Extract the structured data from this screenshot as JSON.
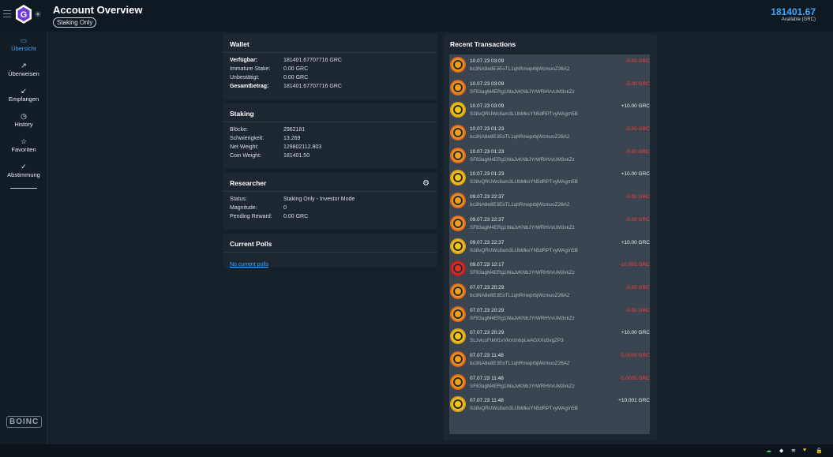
{
  "header": {
    "title": "Account Overview",
    "mode_badge": "Staking Only",
    "balance": "181401.67",
    "balance_label": "Available (GRC)"
  },
  "sidebar": {
    "items": [
      {
        "label": "Übersicht",
        "icon": "overview-icon",
        "glyph": "▭",
        "active": true
      },
      {
        "label": "Überweisen",
        "icon": "send-arrow-icon",
        "glyph": "↗",
        "active": false
      },
      {
        "label": "Empfangen",
        "icon": "receive-arrow-icon",
        "glyph": "↙",
        "active": false
      },
      {
        "label": "History",
        "icon": "clock-icon",
        "glyph": "◷",
        "active": false
      },
      {
        "label": "Favoriten",
        "icon": "star-icon",
        "glyph": "☆",
        "active": false
      },
      {
        "label": "Abstimmung",
        "icon": "check-icon",
        "glyph": "✓",
        "active": false
      }
    ],
    "footer_logo": "BOINC"
  },
  "wallet": {
    "title": "Wallet",
    "rows": [
      {
        "label": "Verfügbar:",
        "value": "181401.67707716 GRC",
        "bold": true
      },
      {
        "label": "Immature Stake:",
        "value": "0.00 GRC",
        "bold": false
      },
      {
        "label": "Unbestätigt:",
        "value": "0.00 GRC",
        "bold": false
      },
      {
        "label": "Gesamtbetrag:",
        "value": "181401.67707716 GRC",
        "bold": true
      }
    ]
  },
  "staking": {
    "title": "Staking",
    "rows": [
      {
        "label": "Blöcke:",
        "value": "2962181"
      },
      {
        "label": "Schwierigkeit:",
        "value": "13.269"
      },
      {
        "label": "Net Weight:",
        "value": "129802112.803"
      },
      {
        "label": "Coin Weight:",
        "value": "181401.50"
      }
    ]
  },
  "researcher": {
    "title": "Researcher",
    "rows": [
      {
        "label": "Status:",
        "value": "Staking Only - Investor Mode"
      },
      {
        "label": "Magnitude:",
        "value": "0"
      },
      {
        "label": "Pending Reward:",
        "value": "0.00 GRC"
      }
    ]
  },
  "polls": {
    "title": "Current Polls",
    "empty_link": "No current polls"
  },
  "transactions": {
    "title": "Recent Transactions",
    "items": [
      {
        "date": "10.07.23 03:09",
        "address": "bc3NA8e8E3EoTL1qhRmeprbjWcmuoZ26A2",
        "amount": "-5.00 GRC",
        "type": "neg",
        "icon": "orange"
      },
      {
        "date": "10.07.23 03:09",
        "address": "SF83agM4ERg1WaJvKNbJYrWRHVvUM3xkZz",
        "amount": "-5.00 GRC",
        "type": "neg",
        "icon": "orange"
      },
      {
        "date": "10.07.23 03:09",
        "address": "S38vQRUWc8am3LUbMksYN5dRPTvyMAgm5B",
        "amount": "+10.00 GRC",
        "type": "pos",
        "icon": "gold"
      },
      {
        "date": "10.07.23 01:23",
        "address": "bc3NA8e8E3EoTL1qhRmeprbjWcmuoZ26A2",
        "amount": "-5.00 GRC",
        "type": "neg",
        "icon": "orange"
      },
      {
        "date": "10.07.23 01:23",
        "address": "SF83agM4ERg1WaJvKNbJYrWRHVvUM3xkZz",
        "amount": "-5.00 GRC",
        "type": "neg",
        "icon": "orange"
      },
      {
        "date": "10.07.23 01:23",
        "address": "S38vQRUWc8am3LUbMksYN5dRPTvyMAgm5B",
        "amount": "+10.00 GRC",
        "type": "pos",
        "icon": "gold"
      },
      {
        "date": "09.07.23 22:37",
        "address": "bc3NA8e8E3EoTL1qhRmeprbjWcmuoZ26A2",
        "amount": "-5.00 GRC",
        "type": "neg",
        "icon": "orange"
      },
      {
        "date": "09.07.23 22:37",
        "address": "SF83agM4ERg1WaJvKNbJYrWRHVvUM3xkZz",
        "amount": "-5.00 GRC",
        "type": "neg",
        "icon": "orange"
      },
      {
        "date": "09.07.23 22:37",
        "address": "S38vQRUWc8am3LUbMksYN5dRPTvyMAgm5B",
        "amount": "+10.00 GRC",
        "type": "pos",
        "icon": "gold"
      },
      {
        "date": "09.07.23 12:17",
        "address": "SF83agM4ERg1WaJvKNbJYrWRHVvUM3xkZz",
        "amount": "-10.001 GRC",
        "type": "neg",
        "icon": "red"
      },
      {
        "date": "07.07.23 20:29",
        "address": "bc3NA8e8E3EoTL1qhRmeprbjWcmuoZ26A2",
        "amount": "-5.00 GRC",
        "type": "neg",
        "icon": "orange"
      },
      {
        "date": "07.07.23 20:29",
        "address": "SF83agM4ERg1WaJvKNbJYrWRHVvUM3xkZz",
        "amount": "-5.00 GRC",
        "type": "neg",
        "icon": "orange"
      },
      {
        "date": "07.07.23 20:29",
        "address": "SLzvicuFtkhf1xVkmznbpLeAGXXo5vgZP3",
        "amount": "+10.00 GRC",
        "type": "pos",
        "icon": "gold"
      },
      {
        "date": "07.07.23 11:48",
        "address": "bc3NA8e8E3EoTL1qhRmeprbjWcmuoZ26A2",
        "amount": "-5.0005 GRC",
        "type": "neg",
        "icon": "orange"
      },
      {
        "date": "07.07.23 11:48",
        "address": "SF83agM4ERg1WaJvKNbJYrWRHVvUM3xkZz",
        "amount": "-5.0005 GRC",
        "type": "neg",
        "icon": "orange"
      },
      {
        "date": "07.07.23 11:48",
        "address": "S38vQRUWc8am3LUbMksYN5dRPTvyMAgm5B",
        "amount": "+10.001 GRC",
        "type": "pos",
        "icon": "gold"
      }
    ]
  },
  "statusbar": {
    "icons": [
      {
        "name": "cloud-sync-icon",
        "glyph": "☁",
        "color": "#2ecc71"
      },
      {
        "name": "stack-icon",
        "glyph": "◆",
        "color": "#e6edf3"
      },
      {
        "name": "wifi-icon",
        "glyph": "≋",
        "color": "#e6edf3"
      },
      {
        "name": "heart-icon",
        "glyph": "♥",
        "color": "#f5c518"
      },
      {
        "name": "lock-icon",
        "glyph": "🔒",
        "color": "#ff3b3b"
      }
    ]
  },
  "colors": {
    "accent": "#3ea6ff",
    "negative": "#ff3b3b",
    "background": "#17212b"
  }
}
